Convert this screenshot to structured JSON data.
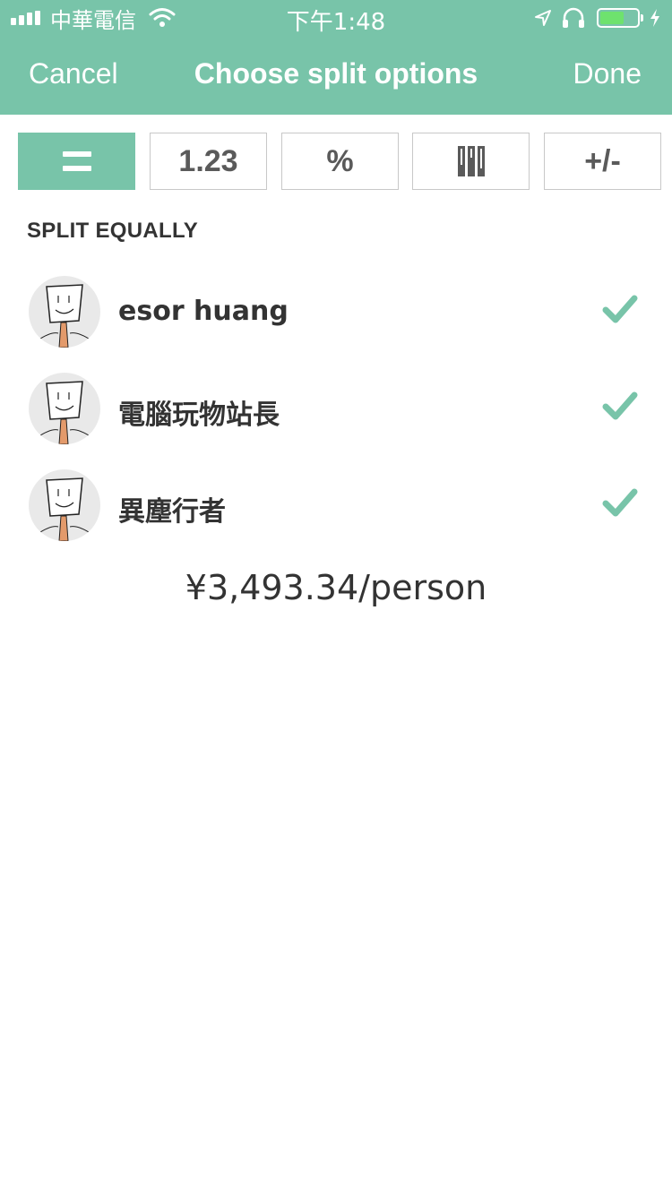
{
  "status_bar": {
    "carrier": "中華電信",
    "time": "下午1:48",
    "icons": [
      "signal-icon",
      "wifi-icon",
      "location-icon",
      "headphones-icon",
      "battery-icon",
      "charging-icon"
    ]
  },
  "nav": {
    "cancel_label": "Cancel",
    "title": "Choose split options",
    "done_label": "Done"
  },
  "split_tabs": [
    {
      "id": "equal",
      "icon": "equals-icon",
      "label": "",
      "active": true
    },
    {
      "id": "exact",
      "label": "1.23",
      "active": false
    },
    {
      "id": "percent",
      "label": "%",
      "active": false
    },
    {
      "id": "shares",
      "icon": "shares-bars-icon",
      "label": "",
      "active": false
    },
    {
      "id": "adjustment",
      "label": "+/-",
      "active": false
    }
  ],
  "section_title": "SPLIT EQUALLY",
  "people": [
    {
      "name": "esor huang",
      "checked": true
    },
    {
      "name": "電腦玩物站長",
      "checked": true
    },
    {
      "name": "異塵行者",
      "checked": true
    }
  ],
  "per_person": "¥3,493.34/person",
  "colors": {
    "accent": "#78c4a9",
    "text": "#333333",
    "border": "#c8c8c8",
    "battery_fill": "#6ee26e"
  }
}
